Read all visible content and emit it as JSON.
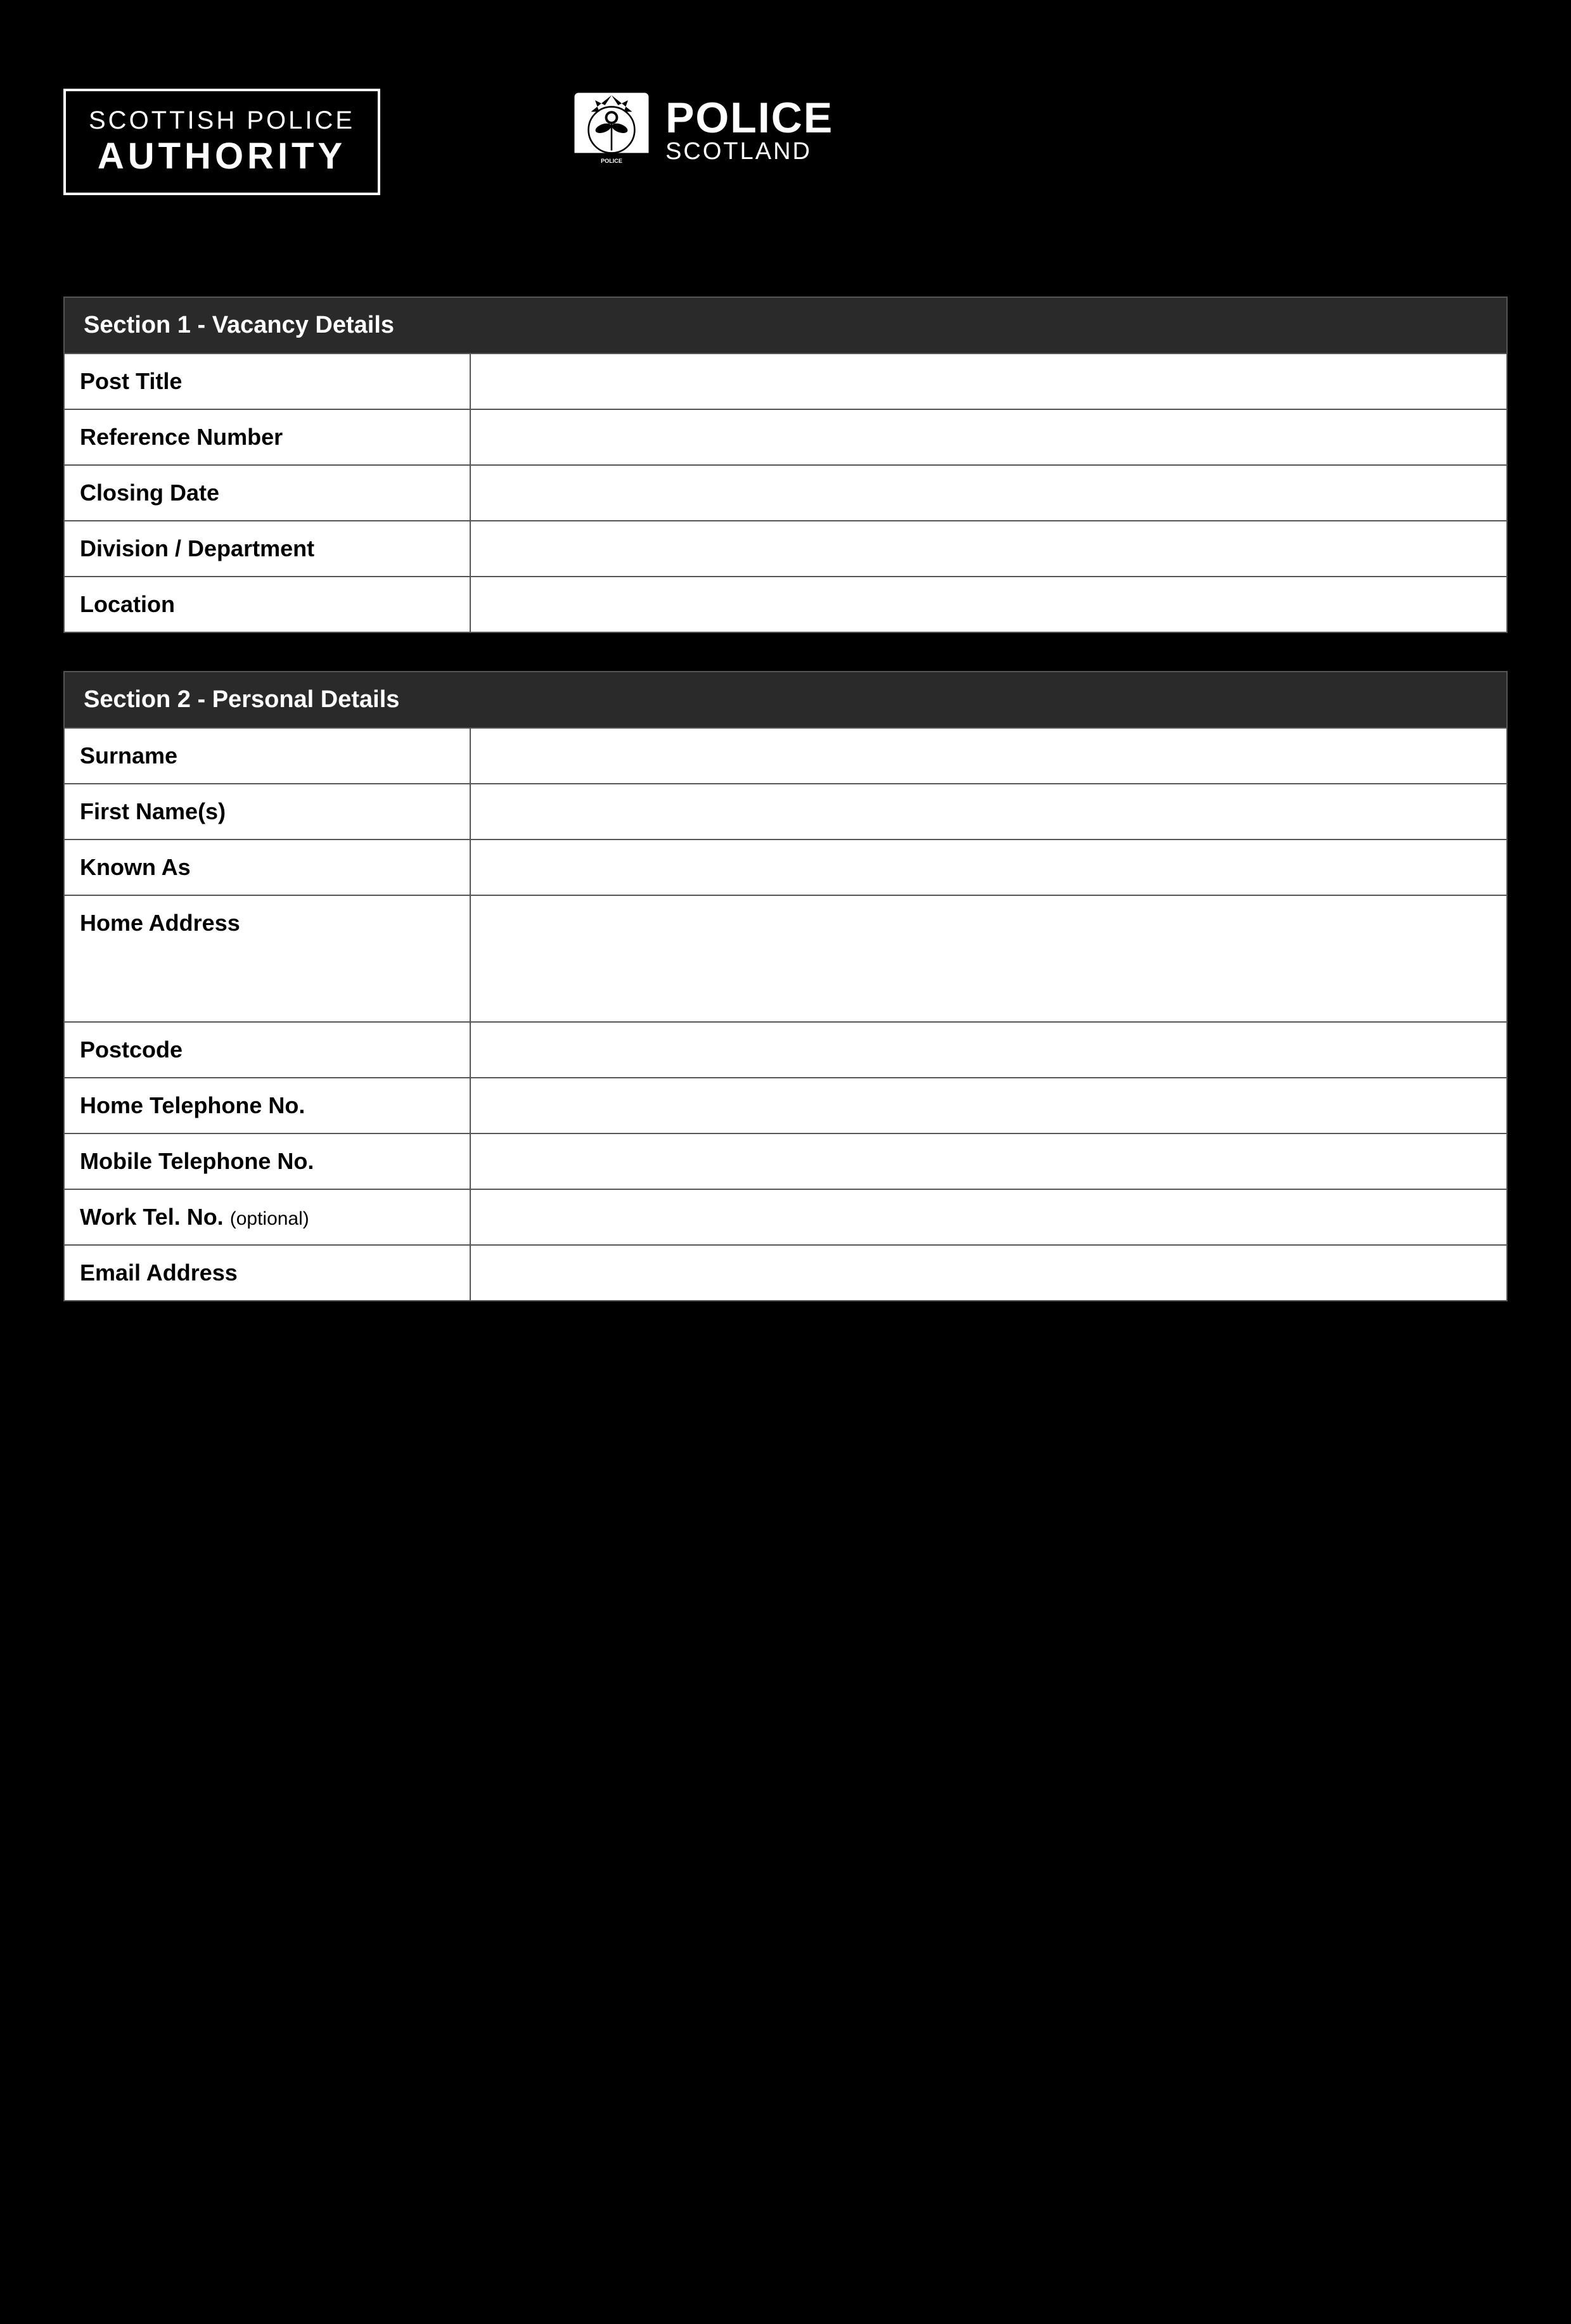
{
  "page": {
    "background": "#000000"
  },
  "header": {
    "spa_logo": {
      "line1": "SCOTTISH POLICE",
      "line2": "AUTHORITY"
    },
    "police_scotland": {
      "line1": "POLICE",
      "line2": "SCOTLAND"
    }
  },
  "section1": {
    "title": "Section 1 - Vacancy Details",
    "fields": [
      {
        "label": "Post Title",
        "optional": false,
        "tall": false
      },
      {
        "label": "Reference Number",
        "optional": false,
        "tall": false
      },
      {
        "label": "Closing Date",
        "optional": false,
        "tall": false
      },
      {
        "label": "Division / Department",
        "optional": false,
        "tall": false
      },
      {
        "label": "Location",
        "optional": false,
        "tall": false
      }
    ]
  },
  "section2": {
    "title": "Section 2 - Personal Details",
    "fields": [
      {
        "label": "Surname",
        "optional": false,
        "tall": false
      },
      {
        "label": "First Name(s)",
        "optional": false,
        "tall": false
      },
      {
        "label": "Known As",
        "optional": false,
        "tall": false
      },
      {
        "label": "Home Address",
        "optional": false,
        "tall": true
      },
      {
        "label": "Postcode",
        "optional": false,
        "tall": false
      },
      {
        "label": "Home Telephone No.",
        "optional": false,
        "tall": false
      },
      {
        "label": "Mobile Telephone No.",
        "optional": false,
        "tall": false
      },
      {
        "label": "Work Tel. No.",
        "optional": true,
        "optional_text": "(optional)",
        "tall": false
      },
      {
        "label": "Email Address",
        "optional": false,
        "tall": false
      }
    ]
  }
}
